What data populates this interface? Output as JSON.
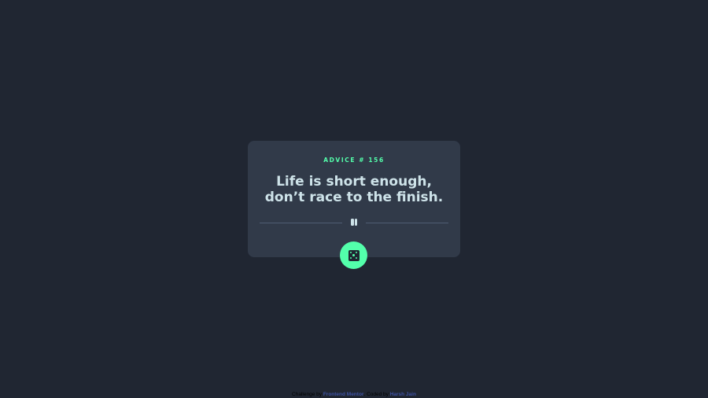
{
  "card": {
    "advice_id": "ADVICE # 156",
    "advice_text": "Life is short enough, don’t race to the finish."
  },
  "icons": {
    "divider": "pause-icon",
    "button": "dice-icon"
  },
  "footer": {
    "challenge_prefix": "Challenge by",
    "challenge_link": "Frontend Mentor",
    "coded_prefix": ". Coded by",
    "coded_link": "Harsh Jain"
  },
  "colors": {
    "background": "#202632",
    "card": "#313a49",
    "accent": "#53ffab",
    "text": "#cee3e9",
    "divider": "#4f5d74",
    "link": "#3e52a3"
  }
}
